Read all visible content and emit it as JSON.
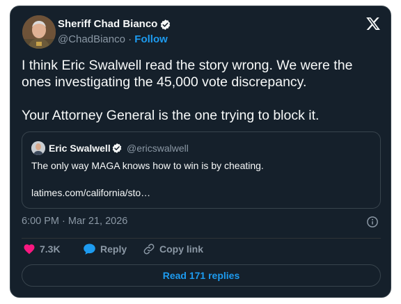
{
  "author": {
    "name": "Sheriff Chad Bianco",
    "handle": "@ChadBianco",
    "separator": "·",
    "follow_label": "Follow"
  },
  "tweet": {
    "paragraph_1": "I think Eric Swalwell read the story wrong. We were the ones investigating the 45,000 vote discrepancy.",
    "paragraph_2": "Your Attorney General is the one trying to block it.",
    "timestamp": "6:00 PM · Mar 21, 2026"
  },
  "quote": {
    "name": "Eric Swalwell",
    "handle": "@ericswalwell",
    "text": "The only way MAGA knows how to win is by cheating.",
    "link": "latimes.com/california/sto…"
  },
  "actions": {
    "like_count": "7.3K",
    "reply_label": "Reply",
    "copy_label": "Copy link"
  },
  "read_replies_label": "Read 171 replies",
  "colors": {
    "background": "#15202b",
    "accent": "#1d9bf0",
    "like": "#f91880",
    "text": "#f7f9f9",
    "muted": "#8b98a5"
  },
  "icons": [
    "verified-icon",
    "x-logo-icon",
    "info-icon",
    "heart-icon",
    "reply-bubble-icon",
    "link-icon"
  ]
}
